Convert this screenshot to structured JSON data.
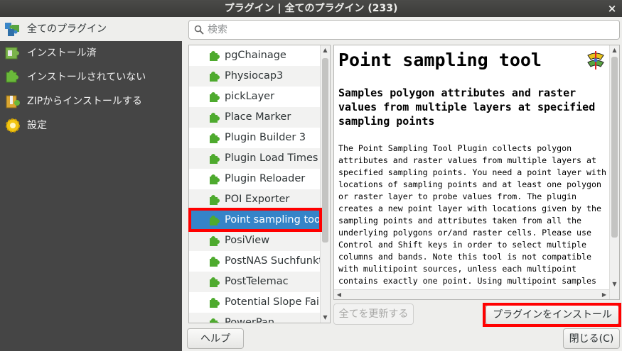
{
  "window": {
    "title": "プラグイン | 全てのプラグイン (233)",
    "close_glyph": "×"
  },
  "sidebar": {
    "items": [
      {
        "label": "全てのプラグイン",
        "icon": "all-plugins-icon",
        "active": true
      },
      {
        "label": "インストール済",
        "icon": "installed-plugins-icon",
        "active": false
      },
      {
        "label": "インストールされていない",
        "icon": "not-installed-plugins-icon",
        "active": false
      },
      {
        "label": "ZIPからインストールする",
        "icon": "zip-install-icon",
        "active": false
      },
      {
        "label": "設定",
        "icon": "settings-gear-icon",
        "active": false
      }
    ]
  },
  "search": {
    "placeholder": "検索",
    "value": ""
  },
  "plugin_list": {
    "items": [
      "pgChainage",
      "Physiocap3",
      "pickLayer",
      "Place Marker",
      "Plugin Builder 3",
      "Plugin Load Times",
      "Plugin Reloader",
      "POI Exporter",
      "Point sampling tool",
      "PosiView",
      "PostNAS Suchfunktion",
      "PostTelemac",
      "Potential Slope Failure",
      "PowerPan"
    ],
    "selected": "Point sampling tool"
  },
  "details": {
    "title": "Point sampling tool",
    "subtitle": "Samples polygon attributes and raster values from multiple layers at specified sampling points",
    "description": "The Point Sampling Tool Plugin collects polygon attributes and raster values from multiple layers at specified sampling points. You need a point layer with locations of sampling points and at least one polygon or raster layer to probe values from. The plugin creates a new point layer with locations given by the sampling points and attributes taken from all the underlying polygons or/and raster cells. Please use Control and Shift keys in order to select multiple columns and bands. Note this tool is not compatible with mulitipoint sources, unless each multipoint contains exactly one point. Using multipoint samples that contain more points in"
  },
  "buttons": {
    "upgrade_all": "全てを更新する",
    "install_plugin": "プラグインをインストール",
    "help": "ヘルプ",
    "close": "閉じる(C)"
  },
  "colors": {
    "selection": "#3584c8",
    "highlight": "#ff0000",
    "sidebar_bg": "#454545"
  }
}
